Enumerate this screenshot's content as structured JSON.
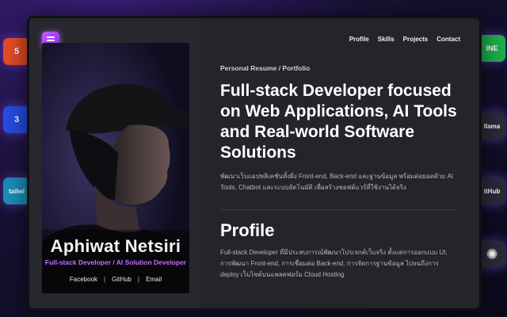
{
  "background_tiles": {
    "left": [
      {
        "icon": "html5-icon",
        "text": "5",
        "color": "#e44d26"
      },
      {
        "icon": "css3-icon",
        "text": "3",
        "color": "#264de4"
      },
      {
        "icon": "tailwind-icon",
        "text": "tailwi",
        "color": "#1b8fb8"
      }
    ],
    "right": [
      {
        "icon": "line-icon",
        "text": "INE",
        "color": "#1fae4b"
      },
      {
        "icon": "ollama-icon",
        "text": "llama",
        "color": "#2a2a3a"
      },
      {
        "icon": "github-icon",
        "text": "itHub",
        "color": "#2a2a3a"
      },
      {
        "icon": "openai-icon",
        "text": "✺",
        "color": "#2a2a3a"
      }
    ]
  },
  "nav": {
    "items": [
      "Profile",
      "Skills",
      "Projects",
      "Contact"
    ]
  },
  "card": {
    "name": "Aphiwat Netsiri",
    "role": "Full-stack Developer / AI Solution Developer",
    "links": [
      "Facebook",
      "GitHub",
      "Email"
    ],
    "separator": "|"
  },
  "hero": {
    "eyebrow": "Personal Resume / Portfolio",
    "headline": "Full-stack Developer focused on Web Applications, AI Tools and Real-world Software Solutions",
    "intro": "พัฒนาเว็บแอปพลิเคชันทั้งฝั่ง Front-end, Back-end และฐานข้อมูล พร้อมต่อยอดด้วย AI Tools, Chatbot และระบบอัตโนมัติ เพื่อสร้างซอฟต์แวร์ที่ใช้งานได้จริง"
  },
  "profile": {
    "title": "Profile",
    "body": "Full-stack Developer ที่มีประสบการณ์พัฒนาโปรเจกต์เว็บจริง ตั้งแต่การออกแบบ UI, การพัฒนา Front-end, การเชื่อมต่อ Back-end, การจัดการฐานข้อมูล ไปจนถึงการ deploy เว็บไซต์บนแพลตฟอร์ม Cloud Hosting"
  },
  "colors": {
    "accent": "#c56cff",
    "panel": "#232529",
    "left_panel": "#26282d"
  }
}
